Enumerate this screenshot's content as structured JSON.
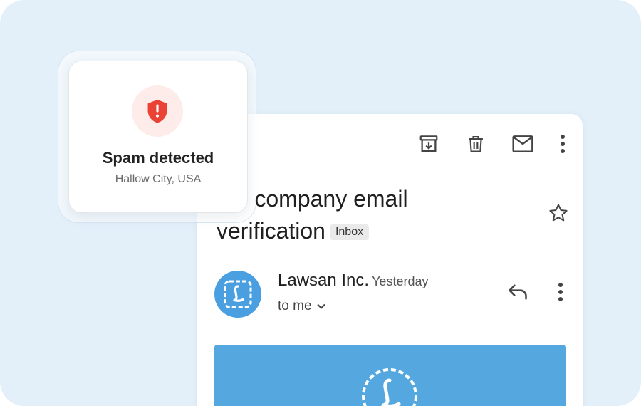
{
  "email": {
    "subject": "...o company email verification",
    "label_chip": "Inbox",
    "sender": {
      "name": "Lawsan Inc.",
      "date": "Yesterday",
      "recipient": "to me"
    }
  },
  "notification": {
    "title": "Spam detected",
    "location": "Hallow City, USA"
  },
  "icons": {
    "toolbar": [
      "archive-icon",
      "trash-icon",
      "mail-icon",
      "more-vert-icon"
    ],
    "star": "star-outline-icon",
    "reply": "reply-icon",
    "alert": "shield-alert-icon",
    "logo": "lawsan-logo"
  },
  "colors": {
    "background": "#e3eff9",
    "brand_blue": "#4a9fe0",
    "banner_blue": "#55a7e0",
    "alert_red": "#ea4335",
    "alert_bg": "#fdece9"
  }
}
